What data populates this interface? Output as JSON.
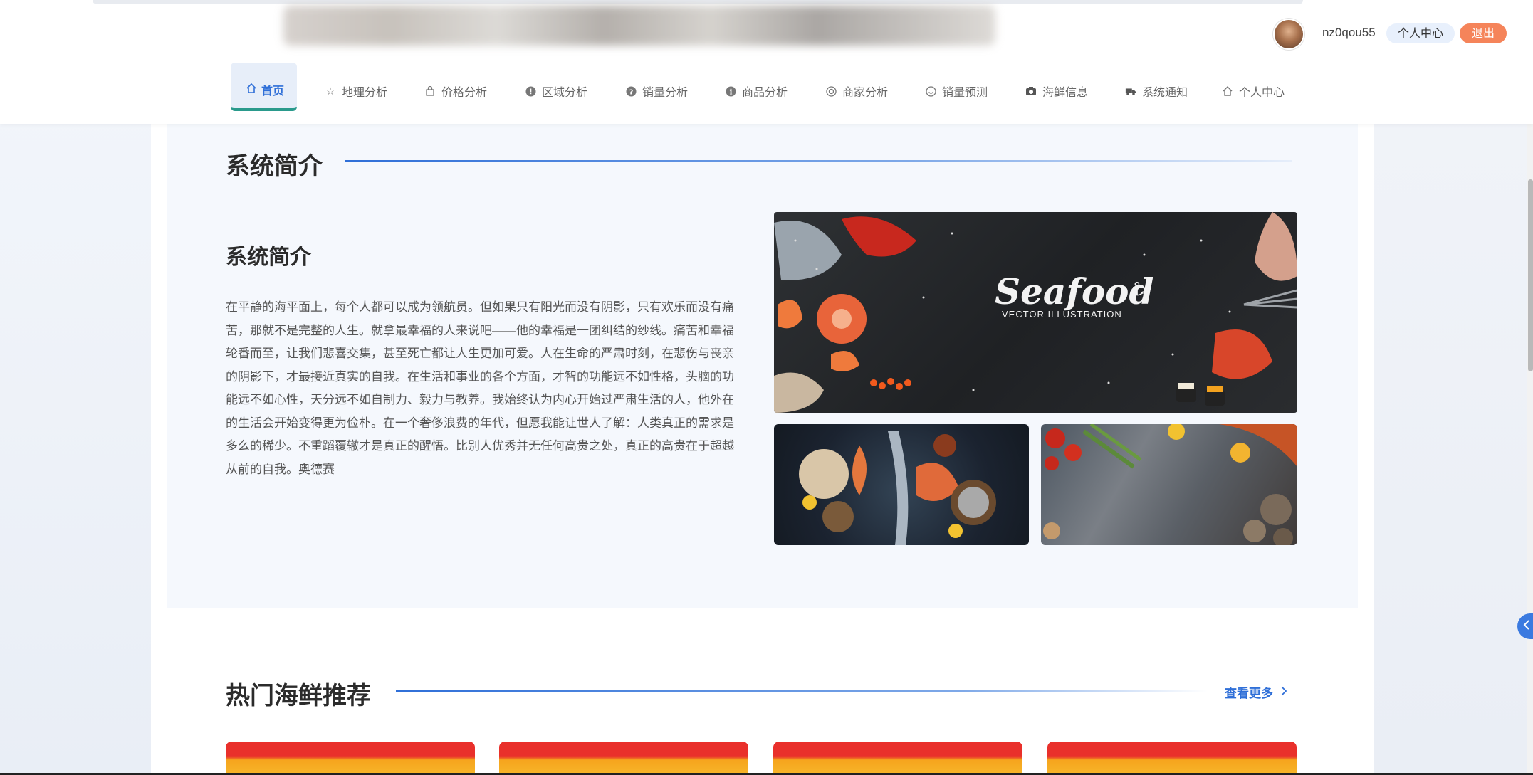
{
  "header": {
    "username": "nz0qou55",
    "profile_button": "个人中心",
    "logout_button": "退出"
  },
  "nav": {
    "items": [
      {
        "label": "首页",
        "icon": "home-icon",
        "active": true
      },
      {
        "label": "地理分析",
        "icon": "star-icon"
      },
      {
        "label": "价格分析",
        "icon": "bag-icon"
      },
      {
        "label": "区域分析",
        "icon": "info-icon"
      },
      {
        "label": "销量分析",
        "icon": "question-icon"
      },
      {
        "label": "商品分析",
        "icon": "info-icon"
      },
      {
        "label": "商家分析",
        "icon": "target-icon"
      },
      {
        "label": "销量预测",
        "icon": "smile-icon"
      },
      {
        "label": "海鲜信息",
        "icon": "camera-icon"
      },
      {
        "label": "系统通知",
        "icon": "truck-icon"
      },
      {
        "label": "个人中心",
        "icon": "home-outline-icon"
      }
    ]
  },
  "intro": {
    "section_title": "系统简介",
    "subtitle": "系统简介",
    "body": "在平静的海平面上，每个人都可以成为领航员。但如果只有阳光而没有阴影，只有欢乐而没有痛苦，那就不是完整的人生。就拿最幸福的人来说吧——他的幸福是一团纠结的纱线。痛苦和幸福轮番而至，让我们悲喜交集，甚至死亡都让人生更加可爱。人在生命的严肃时刻，在悲伤与丧亲的阴影下，才最接近真实的自我。在生活和事业的各个方面，才智的功能远不如性格，头脑的功能远不如心性，天分远不如自制力、毅力与教养。我始终认为内心开始过严肃生活的人，他外在的生活会开始变得更为俭朴。在一个奢侈浪费的年代，但愿我能让世人了解：人类真正的需求是多么的稀少。不重蹈覆辙才是真正的醒悟。比别人优秀并无任何高贵之处，真正的高贵在于超越从前的自我。奥德赛",
    "banner_title": "Seafood",
    "banner_subtitle": "VECTOR ILLUSTRATION"
  },
  "hot": {
    "section_title": "热门海鲜推荐",
    "more_label": "查看更多"
  },
  "colors": {
    "accent": "#2f6fd8",
    "logout": "#f5845a",
    "nav_active_bg": "#e7eef9",
    "nav_active_border": "#2a9a8c"
  }
}
